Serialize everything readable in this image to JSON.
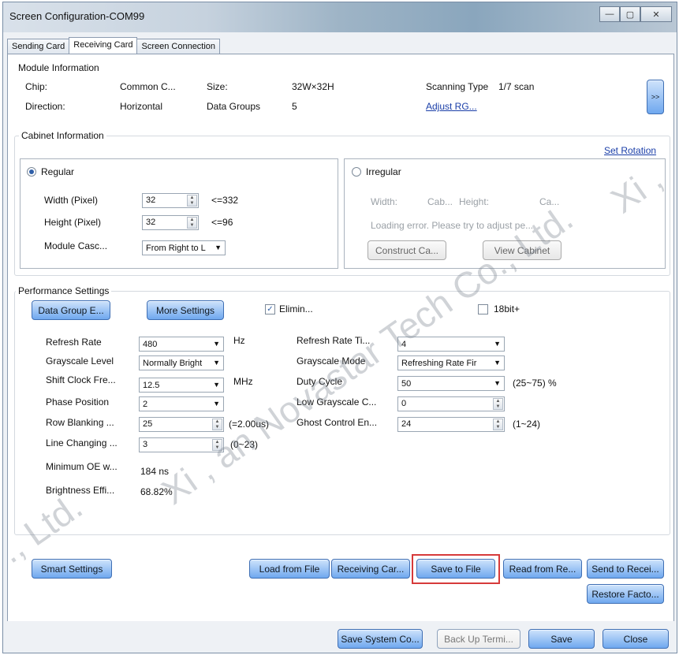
{
  "window": {
    "title": "Screen Configuration-COM99",
    "minimize_glyph": "—",
    "maximize_glyph": "▢",
    "close_glyph": "✕"
  },
  "tabs": [
    "Sending Card",
    "Receiving Card",
    "Screen Connection"
  ],
  "module": {
    "title": "Module Information",
    "chip_label": "Chip:",
    "chip_value": "Common C...",
    "size_label": "Size:",
    "size_value": "32W×32H",
    "scan_label": "Scanning Type",
    "scan_value": "1/7 scan",
    "dir_label": "Direction:",
    "dir_value": "Horizontal",
    "groups_label": "Data Groups",
    "groups_value": "5",
    "adjust_link": "Adjust RG...",
    "expand_button": ">>"
  },
  "cabinet": {
    "title": "Cabinet Information",
    "set_rotation": "Set Rotation",
    "regular": {
      "label": "Regular",
      "width_label": "Width (Pixel)",
      "width_value": "32",
      "width_limit": "<=332",
      "height_label": "Height (Pixel)",
      "height_value": "32",
      "height_limit": "<=96",
      "cascade_label": "Module Casc...",
      "cascade_value": "From Right to L"
    },
    "irregular": {
      "label": "Irregular",
      "width_label": "Width:",
      "cab_label": "Cab...",
      "height_label": "Height:",
      "ca_label": "Ca...",
      "error": "Loading error. Please try to adjust pe...",
      "construct_button": "Construct Ca...",
      "view_button": "View Cabinet"
    }
  },
  "performance": {
    "title": "Performance Settings",
    "data_group_button": "Data Group E...",
    "more_settings_button": "More Settings",
    "elimin_label": "Elimin...",
    "elimin_checked": true,
    "bit18_label": "18bit+",
    "bit18_checked": false,
    "refresh_rate_label": "Refresh Rate",
    "refresh_rate_value": "480",
    "refresh_rate_unit": "Hz",
    "grayscale_level_label": "Grayscale Level",
    "grayscale_level_value": "Normally Bright",
    "shift_clock_label": "Shift Clock Fre...",
    "shift_clock_value": "12.5",
    "shift_clock_unit": "MHz",
    "phase_label": "Phase Position",
    "phase_value": "2",
    "row_blanking_label": "Row Blanking ...",
    "row_blanking_value": "25",
    "row_blanking_note": "(=2.00us)",
    "line_changing_label": "Line Changing ...",
    "line_changing_value": "3",
    "line_changing_note": "(0~23)",
    "min_oe_label": "Minimum OE w...",
    "min_oe_value": "184 ns",
    "brightness_label": "Brightness Effi...",
    "brightness_value": "68.82%",
    "refresh_ti_label": "Refresh Rate Ti...",
    "refresh_ti_value": "4",
    "grayscale_mode_label": "Grayscale Mode",
    "grayscale_mode_value": "Refreshing Rate Fir",
    "duty_label": "Duty Cycle",
    "duty_value": "50",
    "duty_note": "(25~75) %",
    "low_gray_label": "Low Grayscale C...",
    "low_gray_value": "0",
    "ghost_label": "Ghost Control En...",
    "ghost_value": "24",
    "ghost_note": "(1~24)"
  },
  "actions": {
    "smart_settings": "Smart Settings",
    "load_from_file": "Load from File",
    "receiving_car": "Receiving Car...",
    "save_to_file": "Save to File",
    "read_from_re": "Read from Re...",
    "send_to_recei": "Send to Recei...",
    "restore_facto": "Restore Facto..."
  },
  "footer": {
    "save_system": "Save System Co...",
    "back_up": "Back Up Termi...",
    "save": "Save",
    "close": "Close"
  },
  "watermark": {
    "line1": "Xi , an Novastar Tech Co., Ltd.",
    "line2": "., Ltd.",
    "line3": "Xi ,"
  },
  "highlight_color": "#d63a3a",
  "accent_color": "#6fa8ef"
}
